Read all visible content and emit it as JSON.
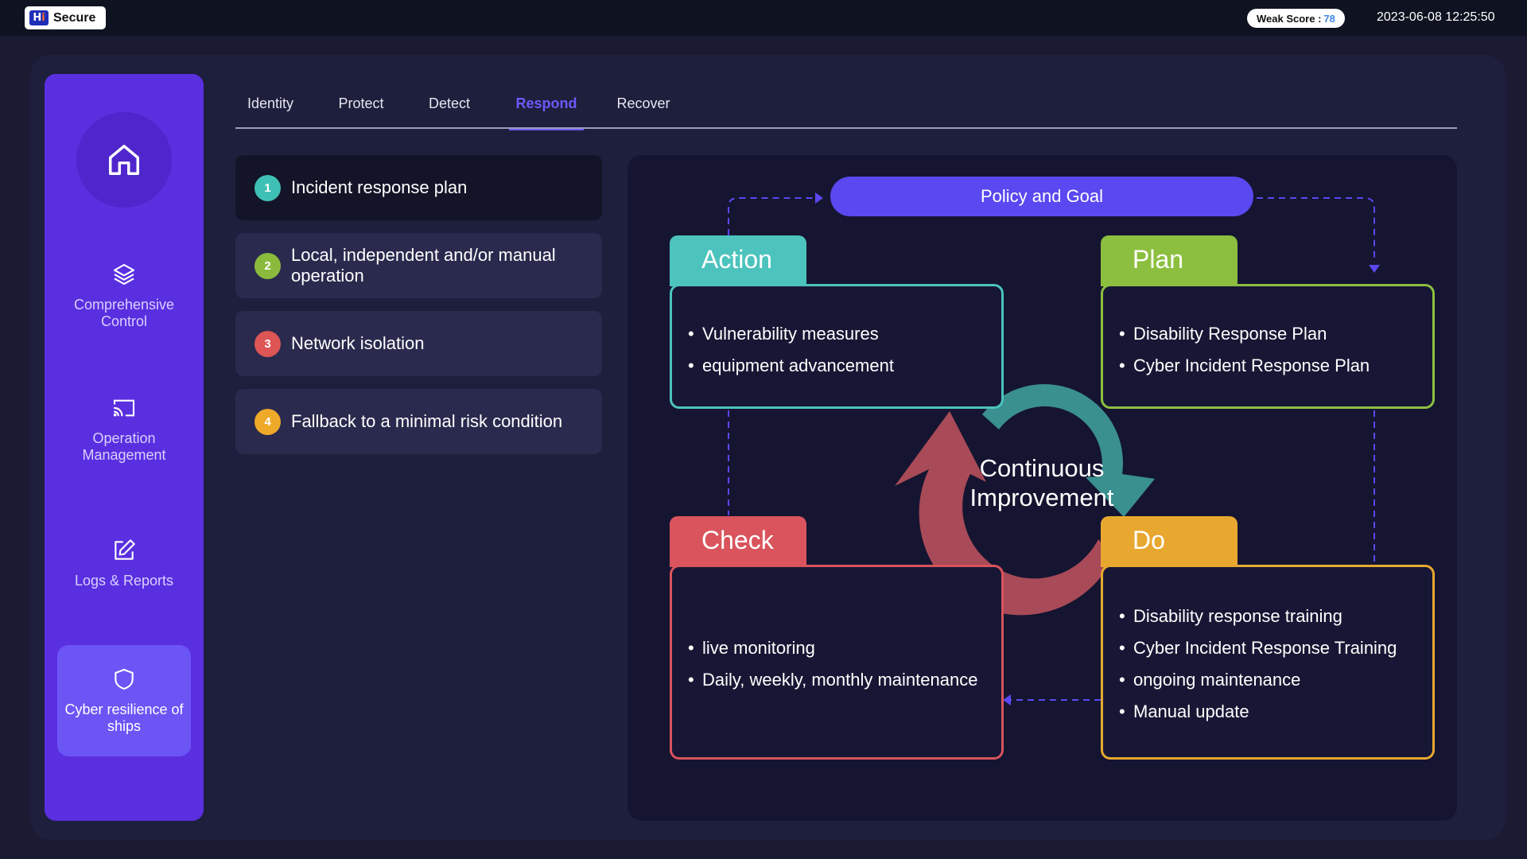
{
  "topbar": {
    "logo_text": "Secure",
    "weak_score_label": "Weak Score :",
    "weak_score_value": "78",
    "datetime": "2023-06-08 12:25:50"
  },
  "sidebar": {
    "items": [
      {
        "label": "Comprehensive Control",
        "icon": "layers-icon",
        "active": false
      },
      {
        "label": "Operation Management",
        "icon": "cast-icon",
        "active": false
      },
      {
        "label": "Logs & Reports",
        "icon": "edit-icon",
        "active": false
      },
      {
        "label": "Cyber resilience of ships",
        "icon": "shield-icon",
        "active": true
      }
    ]
  },
  "tabs": [
    {
      "label": "Identity",
      "active": false
    },
    {
      "label": "Protect",
      "active": false
    },
    {
      "label": "Detect",
      "active": false
    },
    {
      "label": "Respond",
      "active": true
    },
    {
      "label": "Recover",
      "active": false
    }
  ],
  "steps": [
    {
      "num": "1",
      "text": "Incident response plan",
      "color": "#3ec1b4"
    },
    {
      "num": "2",
      "text": "Local, independent and/or manual operation",
      "color": "#8bbb3c"
    },
    {
      "num": "3",
      "text": "Network isolation",
      "color": "#dd5555"
    },
    {
      "num": "4",
      "text": "Fallback to a minimal risk condition",
      "color": "#f0aa2a"
    }
  ],
  "diagram": {
    "policy": "Policy and Goal",
    "center_line1": "Continuous",
    "center_line2": "Improvement",
    "action": {
      "title": "Action",
      "color": "#4cc3bd",
      "items": [
        "Vulnerability measures",
        "equipment advancement"
      ]
    },
    "plan": {
      "title": "Plan",
      "color": "#8cbf3f",
      "items": [
        "Disability Response Plan",
        "Cyber Incident Response Plan"
      ]
    },
    "check": {
      "title": "Check",
      "color": "#d9545c",
      "items": [
        "live monitoring",
        "Daily, weekly, monthly maintenance"
      ]
    },
    "do": {
      "title": "Do",
      "color": "#e8a830",
      "items": [
        "Disability response training",
        "Cyber Incident Response Training",
        "ongoing maintenance",
        "Manual update"
      ]
    }
  }
}
